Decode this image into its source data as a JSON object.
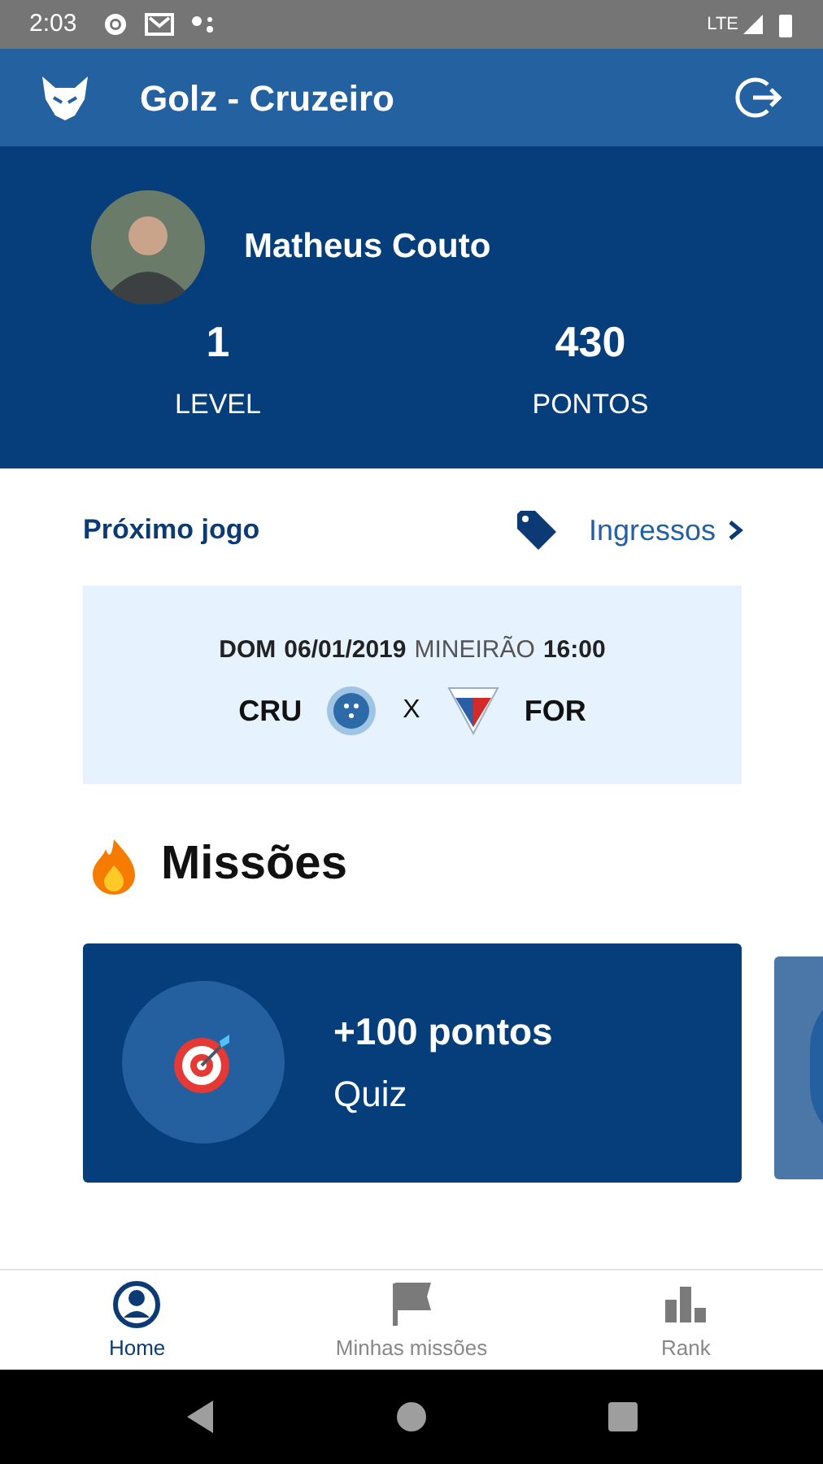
{
  "status_bar": {
    "time": "2:03",
    "network": "LTE"
  },
  "app_bar": {
    "title": "Golz - Cruzeiro"
  },
  "profile": {
    "name": "Matheus Couto",
    "stats": [
      {
        "value": "1",
        "label": "LEVEL"
      },
      {
        "value": "430",
        "label": "PONTOS"
      }
    ]
  },
  "next_game": {
    "title": "Próximo jogo",
    "tickets_link": "Ingressos",
    "weekday": "DOM",
    "date": "06/01/2019",
    "stadium": "MINEIRÃO",
    "time": "16:00",
    "home": "CRU",
    "versus": "X",
    "away": "FOR"
  },
  "missions": {
    "title": "Missões",
    "cards": [
      {
        "points": "+100 pontos",
        "label": "Quiz",
        "selected": true
      },
      {
        "selected": false
      }
    ]
  },
  "bottom_nav": [
    {
      "label": "Home",
      "selected": true
    },
    {
      "label": "Minhas missões",
      "selected": false
    },
    {
      "label": "Rank",
      "selected": false
    }
  ]
}
